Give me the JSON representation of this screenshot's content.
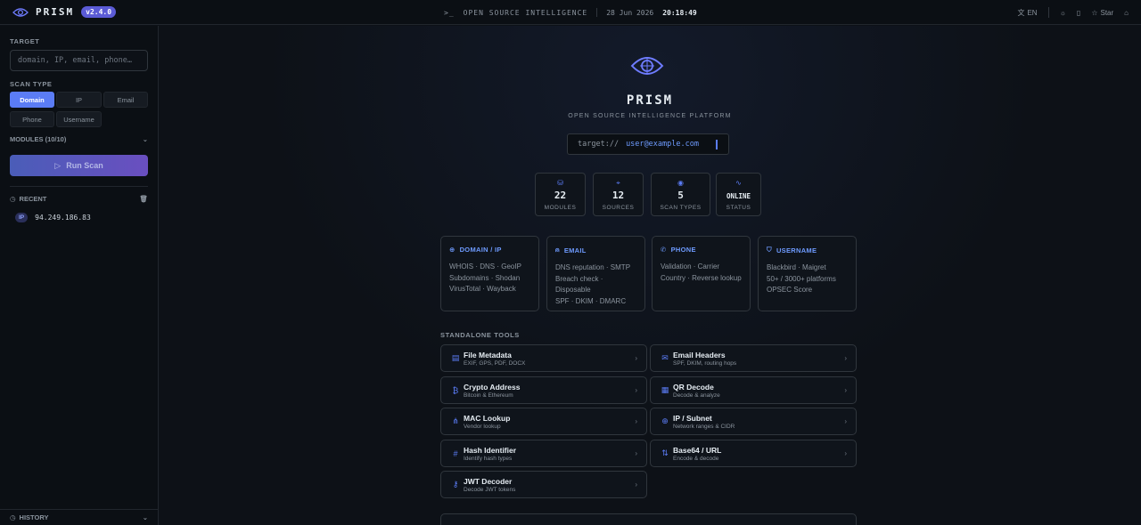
{
  "app": {
    "name": "PRISM",
    "version": "v2.4.0"
  },
  "topbar": {
    "center_label": "OPEN SOURCE INTELLIGENCE",
    "date": "28 Jun 2026",
    "time": "20:18:49",
    "lang": "EN",
    "star_label": "Star"
  },
  "sidebar": {
    "target_label": "TARGET",
    "target_placeholder": "domain, IP, email, phone…",
    "scan_type_label": "SCAN TYPE",
    "scan_types": [
      "Domain",
      "IP",
      "Email",
      "Phone",
      "Username"
    ],
    "active_scan_type": "Domain",
    "modules_label": "MODULES (10/10)",
    "run_label": "Run Scan",
    "recent_label": "RECENT",
    "recent": [
      {
        "badge": "IP",
        "value": "94.249.186.83"
      }
    ],
    "history_label": "HISTORY"
  },
  "hero": {
    "title": "PRISM",
    "subtitle": "OPEN SOURCE INTELLIGENCE PLATFORM",
    "terminal_prefix": "target://",
    "terminal_value": "user@example.com"
  },
  "stats": [
    {
      "icon": "database-icon",
      "value": "22",
      "label": "MODULES"
    },
    {
      "icon": "crosshair-icon",
      "value": "12",
      "label": "SOURCES"
    },
    {
      "icon": "eye-icon",
      "value": "5",
      "label": "SCAN TYPES"
    },
    {
      "icon": "pulse-icon",
      "value": "ONLINE",
      "label": "STATUS"
    }
  ],
  "categories": [
    {
      "title": "DOMAIN / IP",
      "icon": "globe-icon",
      "lines": [
        "WHOIS · DNS · GeoIP",
        "Subdomains · Shodan",
        "VirusTotal · Wayback"
      ]
    },
    {
      "title": "EMAIL",
      "icon": "user-icon",
      "lines": [
        "DNS reputation · SMTP",
        "Breach check ·",
        "Disposable",
        "SPF · DKIM · DMARC"
      ]
    },
    {
      "title": "PHONE",
      "icon": "phone-icon",
      "lines": [
        "Validation · Carrier",
        "Country · Reverse lookup"
      ]
    },
    {
      "title": "USERNAME",
      "icon": "shield-icon",
      "lines": [
        "Blackbird · Maigret",
        "50+ / 3000+ platforms",
        "OPSEC Score"
      ]
    }
  ],
  "tools_label": "STANDALONE TOOLS",
  "tools": [
    {
      "name": "File Metadata",
      "desc": "EXIF, GPS, PDF, DOCX",
      "icon": "file-icon"
    },
    {
      "name": "Email Headers",
      "desc": "SPF, DKIM, routing hops",
      "icon": "mail-icon"
    },
    {
      "name": "Crypto Address",
      "desc": "Bitcoin & Ethereum",
      "icon": "bitcoin-icon"
    },
    {
      "name": "QR Decode",
      "desc": "Decode & analyze",
      "icon": "qr-icon"
    },
    {
      "name": "MAC Lookup",
      "desc": "Vendor lookup",
      "icon": "network-icon"
    },
    {
      "name": "IP / Subnet",
      "desc": "Network ranges & CIDR",
      "icon": "globe-icon"
    },
    {
      "name": "Hash Identifier",
      "desc": "Identify hash types",
      "icon": "hash-icon"
    },
    {
      "name": "Base64 / URL",
      "desc": "Encode & decode",
      "icon": "swap-icon"
    },
    {
      "name": "JWT Decoder",
      "desc": "Decode JWT tokens",
      "icon": "key-icon"
    }
  ],
  "colors": {
    "accent": "#5b7cf5",
    "accent_text": "#6e9bff",
    "background": "#0d1117",
    "border": "#30363d"
  }
}
